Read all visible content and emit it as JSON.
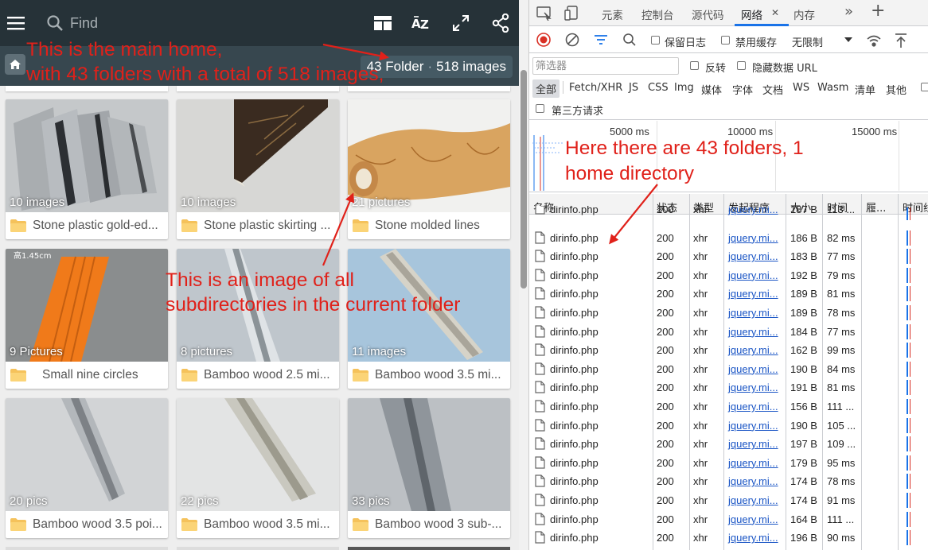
{
  "gallery": {
    "search_placeholder": "Find",
    "folder_count": "43 Folder",
    "image_count": "518 images",
    "separator": "·",
    "cards": [
      {
        "count": "10 images",
        "label": "Stone plastic gold-ed..."
      },
      {
        "count": "10 images",
        "label": "Stone plastic skirting ..."
      },
      {
        "count": "21 pictures",
        "label": "Stone molded lines"
      },
      {
        "count": "9 Pictures",
        "label": "Small nine circles",
        "badge": "高1.45cm"
      },
      {
        "count": "8 pictures",
        "label": "Bamboo wood 2.5 mi..."
      },
      {
        "count": "11 images",
        "label": "Bamboo wood 3.5 mi..."
      },
      {
        "count": "20 pics",
        "label": "Bamboo wood 3.5 poi..."
      },
      {
        "count": "22 pics",
        "label": "Bamboo wood 3.5 mi..."
      },
      {
        "count": "33 pics",
        "label": "Bamboo wood 3 sub-..."
      }
    ]
  },
  "annotations": {
    "main_home_line1": "This is the main home,",
    "main_home_line2": "with 43 folders with a total of 518 images,",
    "subdir_line1": "This is an image of all",
    "subdir_line2": "subdirectories in the current folder",
    "net_line1": "Here there are 43 folders, 1",
    "net_line2": "home directory"
  },
  "devtools": {
    "tabs": [
      "元素",
      "控制台",
      "源代码",
      "网络",
      "内存"
    ],
    "active_tab": "网络",
    "close_glyph": "✕",
    "more_glyph": "»",
    "add_glyph": "+",
    "preserve_log": "保留日志",
    "disable_cache": "禁用缓存",
    "throttle": "无限制",
    "filter_placeholder": "筛选器",
    "invert": "反转",
    "hide_data_urls": "隐藏数据 URL",
    "type_filters": [
      "全部",
      "Fetch/XHR",
      "JS",
      "CSS",
      "Img",
      "媒体",
      "字体",
      "文档",
      "WS",
      "Wasm",
      "清单",
      "其他"
    ],
    "third_party": "第三方请求",
    "timeline_ticks": [
      "5000 ms",
      "10000 ms",
      "15000 ms"
    ],
    "columns": [
      "名称",
      "状态",
      "类型",
      "发起程序",
      "大小",
      "时间",
      "履...",
      "时间线"
    ],
    "rows": [
      {
        "name": "dirinfo.php",
        "status": "200",
        "type": "xhr",
        "initiator": "jquery.mi...",
        "size": "187 B",
        "time": "113 ..."
      },
      {
        "name": "dirinfo.php",
        "status": "200",
        "type": "xhr",
        "initiator": "jquery.mi...",
        "size": "186 B",
        "time": "82 ms"
      },
      {
        "name": "dirinfo.php",
        "status": "200",
        "type": "xhr",
        "initiator": "jquery.mi...",
        "size": "183 B",
        "time": "77 ms"
      },
      {
        "name": "dirinfo.php",
        "status": "200",
        "type": "xhr",
        "initiator": "jquery.mi...",
        "size": "192 B",
        "time": "79 ms"
      },
      {
        "name": "dirinfo.php",
        "status": "200",
        "type": "xhr",
        "initiator": "jquery.mi...",
        "size": "189 B",
        "time": "81 ms"
      },
      {
        "name": "dirinfo.php",
        "status": "200",
        "type": "xhr",
        "initiator": "jquery.mi...",
        "size": "189 B",
        "time": "78 ms"
      },
      {
        "name": "dirinfo.php",
        "status": "200",
        "type": "xhr",
        "initiator": "jquery.mi...",
        "size": "184 B",
        "time": "77 ms"
      },
      {
        "name": "dirinfo.php",
        "status": "200",
        "type": "xhr",
        "initiator": "jquery.mi...",
        "size": "162 B",
        "time": "99 ms"
      },
      {
        "name": "dirinfo.php",
        "status": "200",
        "type": "xhr",
        "initiator": "jquery.mi...",
        "size": "190 B",
        "time": "84 ms"
      },
      {
        "name": "dirinfo.php",
        "status": "200",
        "type": "xhr",
        "initiator": "jquery.mi...",
        "size": "191 B",
        "time": "81 ms"
      },
      {
        "name": "dirinfo.php",
        "status": "200",
        "type": "xhr",
        "initiator": "jquery.mi...",
        "size": "156 B",
        "time": "111 ..."
      },
      {
        "name": "dirinfo.php",
        "status": "200",
        "type": "xhr",
        "initiator": "jquery.mi...",
        "size": "190 B",
        "time": "105 ..."
      },
      {
        "name": "dirinfo.php",
        "status": "200",
        "type": "xhr",
        "initiator": "jquery.mi...",
        "size": "197 B",
        "time": "109 ..."
      },
      {
        "name": "dirinfo.php",
        "status": "200",
        "type": "xhr",
        "initiator": "jquery.mi...",
        "size": "179 B",
        "time": "95 ms"
      },
      {
        "name": "dirinfo.php",
        "status": "200",
        "type": "xhr",
        "initiator": "jquery.mi...",
        "size": "174 B",
        "time": "78 ms"
      },
      {
        "name": "dirinfo.php",
        "status": "200",
        "type": "xhr",
        "initiator": "jquery.mi...",
        "size": "174 B",
        "time": "91 ms"
      },
      {
        "name": "dirinfo.php",
        "status": "200",
        "type": "xhr",
        "initiator": "jquery.mi...",
        "size": "164 B",
        "time": "111 ..."
      },
      {
        "name": "dirinfo.php",
        "status": "200",
        "type": "xhr",
        "initiator": "jquery.mi...",
        "size": "196 B",
        "time": "90 ms"
      }
    ]
  },
  "colors": {
    "topbar": "#263238",
    "breadcrumb": "#37474f",
    "annotation_red": "#e0211a",
    "devtools_blue": "#1a73e8",
    "folder_icon": "#f5c25b"
  }
}
